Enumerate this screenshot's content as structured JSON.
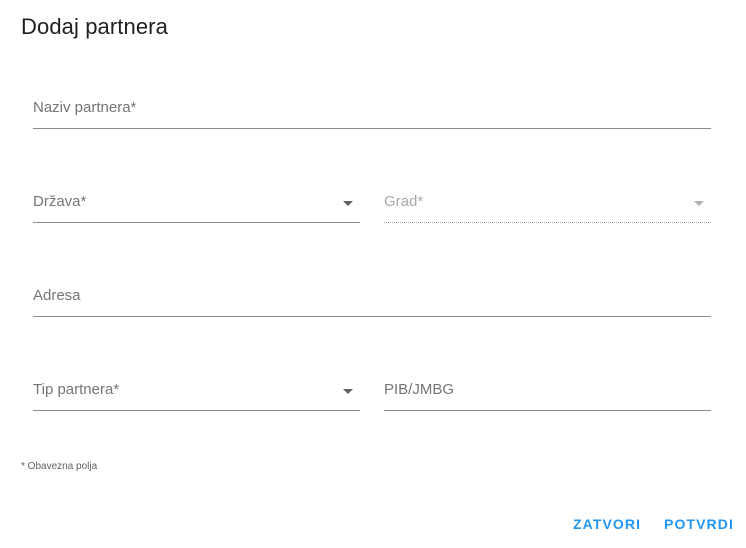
{
  "dialog": {
    "title": "Dodaj partnera",
    "required_note": "* Obavezna polja"
  },
  "fields": {
    "partner_name": {
      "label": "Naziv partnera*",
      "value": ""
    },
    "country": {
      "label": "Država*",
      "value": "",
      "icon": "chevron-down-icon"
    },
    "city": {
      "label": "Grad*",
      "value": "",
      "disabled": true,
      "icon": "chevron-down-icon"
    },
    "address": {
      "label": "Adresa",
      "value": ""
    },
    "partner_type": {
      "label": "Tip partnera*",
      "value": "",
      "icon": "chevron-down-icon"
    },
    "pib_jmbg": {
      "label": "PIB/JMBG",
      "value": ""
    }
  },
  "actions": {
    "close_label": "ZATVORI",
    "confirm_label": "POTVRDI"
  },
  "colors": {
    "accent": "#2196f3",
    "title": "#212121",
    "label": "#757575",
    "underline": "#8a8a8a",
    "disabled": "#a9a9a9"
  }
}
